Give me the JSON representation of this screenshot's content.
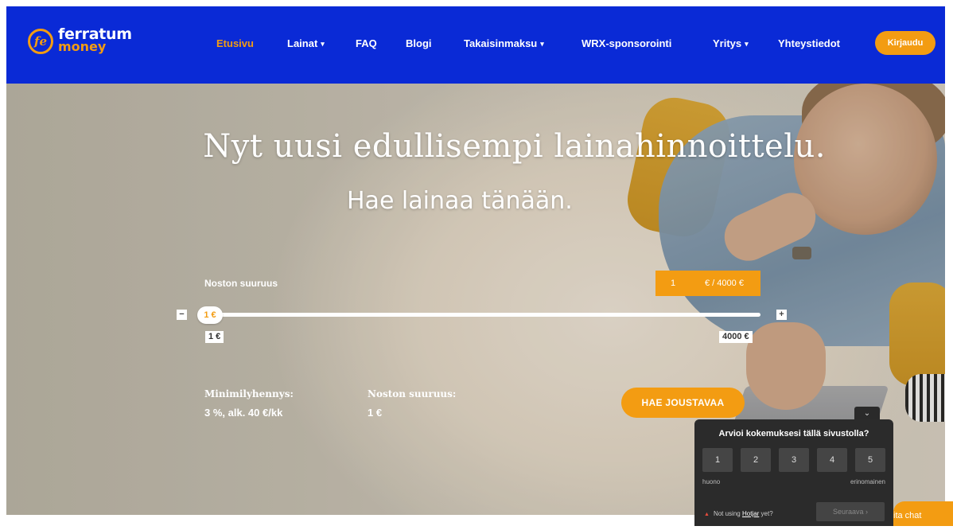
{
  "brand": {
    "name": "ferratum",
    "sub": "money",
    "mark": "fe"
  },
  "nav": {
    "items": [
      {
        "label": "Etusivu",
        "active": true,
        "dropdown": false
      },
      {
        "label": "Lainat",
        "active": false,
        "dropdown": true
      },
      {
        "label": "FAQ",
        "active": false,
        "dropdown": false
      },
      {
        "label": "Blogi",
        "active": false,
        "dropdown": false
      },
      {
        "label": "Takaisinmaksu",
        "active": false,
        "dropdown": true
      },
      {
        "label": "WRX-sponsorointi",
        "active": false,
        "dropdown": false
      },
      {
        "label": "Yritys",
        "active": false,
        "dropdown": true
      },
      {
        "label": "Yhteystiedot",
        "active": false,
        "dropdown": false
      }
    ],
    "login_label": "Kirjaudu"
  },
  "hero": {
    "title": "Nyt uusi edullisempi lainahinnoittelu.",
    "subtitle": "Hae lainaa tänään."
  },
  "calculator": {
    "amount_label": "Noston suuruus",
    "amount_value": "1",
    "amount_unit": "€ / 4000 €",
    "minus": "−",
    "plus": "+",
    "slider_value_label": "1 €",
    "slider_fraction": 0,
    "min_label": "1 €",
    "max_label": "4000 €",
    "min_payment_label": "Minimilyhennys:",
    "min_payment_value": "3 %, alk. 40 €/kk",
    "withdrawal_label": "Noston suuruus:",
    "withdrawal_value": "1 €",
    "cta_label": "HAE JOUSTAVAA"
  },
  "feedback": {
    "toggle": "⌄",
    "question": "Arvioi kokemuksesi tällä sivustolla?",
    "options": [
      "1",
      "2",
      "3",
      "4",
      "5"
    ],
    "low_label": "huono",
    "high_label": "erinomainen",
    "footer_prefix": "Not using",
    "footer_link": "Hotjar",
    "footer_suffix": "yet?",
    "next_label": "Seuraava  ›"
  },
  "chat": {
    "label": "ita chat"
  },
  "colors": {
    "nav_bg": "#0a2ad6",
    "accent": "#f39c12",
    "widget_bg": "#2b2b2b"
  }
}
